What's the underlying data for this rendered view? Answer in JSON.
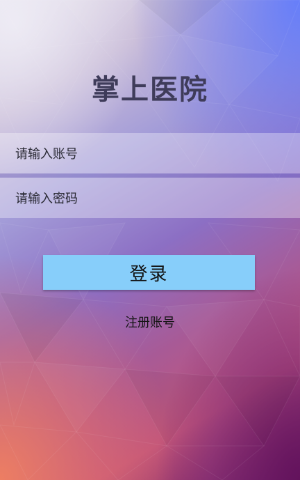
{
  "app": {
    "title": "掌上医院"
  },
  "form": {
    "account_placeholder": "请输入账号",
    "password_placeholder": "请输入密码",
    "login_label": "登录",
    "register_label": "注册账号"
  },
  "colors": {
    "title_text": "#3f3c5a",
    "login_button": "#87cefa",
    "field_background": "rgba(255,255,255,0.33)"
  }
}
